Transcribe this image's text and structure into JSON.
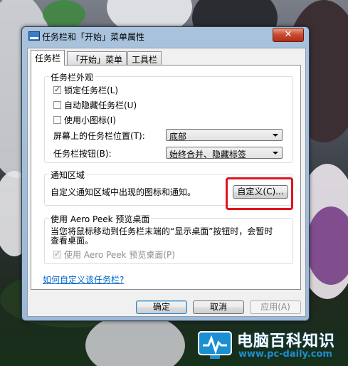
{
  "window": {
    "title": "任务栏和「开始」菜单属性",
    "close_glyph": "✕"
  },
  "tabs": [
    {
      "label": "任务栏",
      "active": true
    },
    {
      "label": "「开始」菜单",
      "active": false
    },
    {
      "label": "工具栏",
      "active": false
    }
  ],
  "appearance": {
    "group_title": "任务栏外观",
    "lock_taskbar": {
      "label": "锁定任务栏(L)",
      "checked": true
    },
    "auto_hide": {
      "label": "自动隐藏任务栏(U)",
      "checked": false
    },
    "small_icons": {
      "label": "使用小图标(I)",
      "checked": false
    },
    "location_label": "屏幕上的任务栏位置(T):",
    "location_value": "底部",
    "buttons_label": "任务栏按钮(B):",
    "buttons_value": "始终合并、隐藏标签"
  },
  "notification": {
    "group_title": "通知区域",
    "description": "自定义通知区域中出现的图标和通知。",
    "customize_button": "自定义(C)..."
  },
  "aero_peek": {
    "group_title": "使用 Aero Peek 预览桌面",
    "description_line1": "当您将鼠标移动到任务栏末端的“显示桌面”按钮时，会暂时",
    "description_line2": "查看桌面。",
    "checkbox": {
      "label": "使用 Aero Peek 预览桌面(P)",
      "checked": true,
      "disabled": true
    }
  },
  "help_link": "如何自定义该任务栏?",
  "footer": {
    "ok": "确定",
    "cancel": "取消",
    "apply": "应用(A)"
  },
  "watermark": {
    "name": "电脑百科知识",
    "url": "www.pc-daily.com"
  },
  "colors": {
    "highlight_frame": "#e0151d",
    "link": "#0066cc",
    "watermark_url": "#1a8fd1"
  }
}
